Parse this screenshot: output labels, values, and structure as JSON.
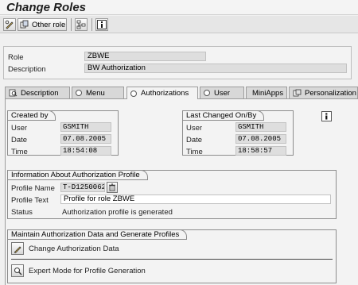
{
  "title": "Change Roles",
  "toolbar": {
    "other_role_label": "Other role"
  },
  "role": {
    "role_label": "Role",
    "role_value": "ZBWE",
    "description_label": "Description",
    "description_value": "BW Authorization"
  },
  "tabs": [
    {
      "label": "Description",
      "icon": "tab-clipboard-icon"
    },
    {
      "label": "Menu",
      "icon": "radio-icon"
    },
    {
      "label": "Authorizations",
      "icon": "radio-icon",
      "active": true
    },
    {
      "label": "User",
      "icon": "radio-icon"
    },
    {
      "label": "MiniApps",
      "icon": "none"
    },
    {
      "label": "Personalization",
      "icon": "tab-personalization-icon"
    }
  ],
  "created": {
    "title": "Created by",
    "user_label": "User",
    "user_value": "GSMITH",
    "date_label": "Date",
    "date_value": "07.08.2005",
    "time_label": "Time",
    "time_value": "18:54:08"
  },
  "changed": {
    "title": "Last Changed On/By",
    "user_label": "User",
    "user_value": "GSMITH",
    "date_label": "Date",
    "date_value": "07.08.2005",
    "time_label": "Time",
    "time_value": "18:58:57"
  },
  "profile": {
    "title": "Information About Authorization Profile",
    "name_label": "Profile Name",
    "name_value": "T-D1250062",
    "text_label": "Profile Text",
    "text_value": "Profile for role ZBWE",
    "status_label": "Status",
    "status_value": "Authorization profile is generated"
  },
  "maintain": {
    "title": "Maintain Authorization Data and Generate Profiles",
    "change_label": "Change Authorization Data",
    "expert_label": "Expert Mode for Profile Generation"
  }
}
